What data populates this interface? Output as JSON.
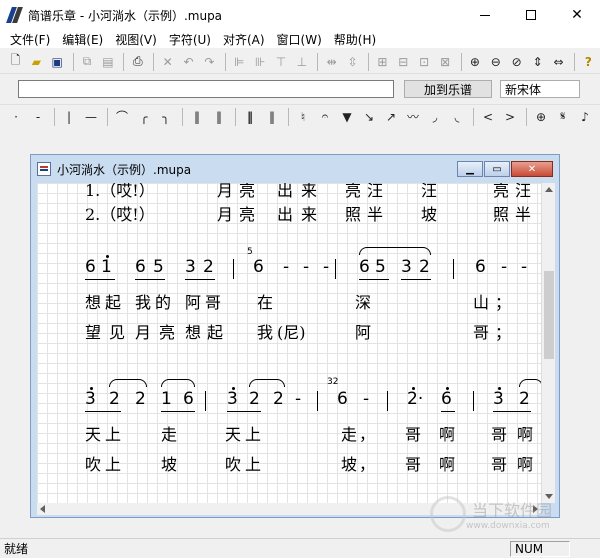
{
  "app": {
    "title": "简谱乐章 - 小河淌水（示例）.mupa"
  },
  "menu": [
    "文件(F)",
    "编辑(E)",
    "视图(V)",
    "字符(U)",
    "对齐(A)",
    "窗口(W)",
    "帮助(H)"
  ],
  "toolbar2": {
    "input_value": "",
    "add_button": "加到乐谱",
    "font": "新宋体"
  },
  "document": {
    "title": "小河淌水（示例）.mupa",
    "verse_top": {
      "line1": [
        "1.（哎!）",
        "月",
        "亮",
        "出",
        "来",
        "亮",
        "汪",
        "汪",
        "亮",
        "汪"
      ],
      "line2": [
        "2.（哎!）",
        "月",
        "亮",
        "出",
        "来",
        "照",
        "半",
        "坡",
        "照",
        "半"
      ]
    },
    "system1": {
      "notes": [
        "6",
        "1",
        "6",
        "5",
        "3",
        "2",
        "6",
        "-",
        "-",
        "-",
        "6",
        "5",
        "3",
        "2",
        "6",
        "-",
        "-"
      ],
      "grace": "5",
      "lyric1": [
        "想",
        "起",
        "我",
        "的",
        "阿",
        "哥",
        "在",
        "深",
        "山",
        "；"
      ],
      "lyric2": [
        "望",
        "见",
        "月",
        "亮",
        "想",
        "起",
        "我",
        "(尼)",
        "阿",
        "哥",
        "；"
      ]
    },
    "system2": {
      "notes": [
        "3",
        "2",
        "2",
        "1",
        "6",
        "3",
        "2",
        "2",
        "-",
        "6",
        "-",
        "2·",
        "6",
        "3",
        "2"
      ],
      "grace": "32",
      "lyric1": [
        "天",
        "上",
        "走",
        "天",
        "上",
        "走",
        "，",
        "哥",
        "啊",
        "哥",
        "啊"
      ],
      "lyric2": [
        "吹",
        "上",
        "坡",
        "吹",
        "上",
        "坡",
        "，",
        "哥",
        "啊",
        "哥",
        "啊"
      ]
    }
  },
  "status": {
    "left": "就绪",
    "num": "NUM"
  },
  "watermark": {
    "text": "当下软件园",
    "sub": "www.downxia.com"
  }
}
